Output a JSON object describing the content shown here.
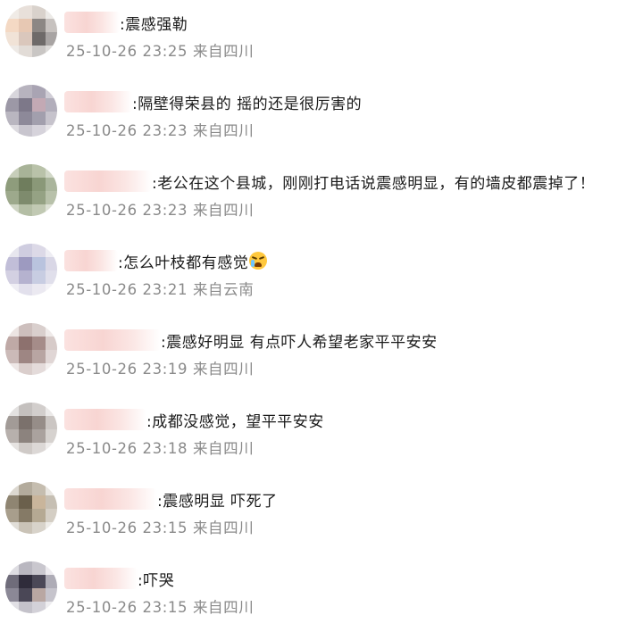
{
  "comments": [
    {
      "content": ":震感强勒",
      "time": "25-10-26 23:25",
      "location": "来自四川"
    },
    {
      "content": ":隔壁得荣县的 摇的还是很厉害的",
      "time": "25-10-26 23:23",
      "location": "来自四川"
    },
    {
      "content": ":老公在这个县城，刚刚打电话说震感明显，有的墙皮都震掉了！",
      "time": "25-10-26 23:23",
      "location": "来自四川"
    },
    {
      "content": ":怎么叶枝都有感觉",
      "emoji": "crying-face",
      "time": "25-10-26 23:21",
      "location": "来自云南"
    },
    {
      "content": ":震感好明显 有点吓人希望老家平平安安",
      "time": "25-10-26 23:19",
      "location": "来自四川"
    },
    {
      "content": ":成都没感觉，望平平安安",
      "time": "25-10-26 23:18",
      "location": "来自四川"
    },
    {
      "content": ":震感明显 吓死了",
      "time": "25-10-26 23:15",
      "location": "来自四川"
    },
    {
      "content": ":吓哭",
      "time": "25-10-26 23:15",
      "location": "来自四川"
    }
  ],
  "colors": {
    "text": "#1a1a1a",
    "meta": "#8a8a8a",
    "name_blur": "#f8d5d2"
  }
}
